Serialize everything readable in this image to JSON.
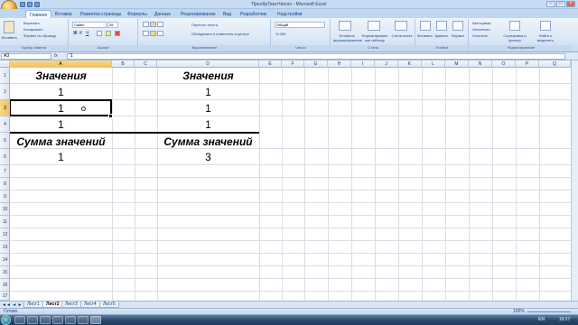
{
  "window": {
    "title": "ПреобрТекстЧисло - Microsoft Excel"
  },
  "tabs": [
    {
      "label": "Главная",
      "active": true
    },
    {
      "label": "Вставка",
      "active": false
    },
    {
      "label": "Разметка страницы",
      "active": false
    },
    {
      "label": "Формулы",
      "active": false
    },
    {
      "label": "Данные",
      "active": false
    },
    {
      "label": "Рецензирование",
      "active": false
    },
    {
      "label": "Вид",
      "active": false
    },
    {
      "label": "Разработчик",
      "active": false
    },
    {
      "label": "Надстройки",
      "active": false
    }
  ],
  "ribbon": {
    "clipboard": {
      "paste": "Вставить",
      "cut": "Вырезать",
      "copy": "Копировать",
      "format_painter": "Формат по образцу",
      "label": "Буфер обмена"
    },
    "font": {
      "name": "Calibri",
      "size": "26",
      "label": "Шрифт"
    },
    "alignment": {
      "wrap": "Перенос текста",
      "merge": "Объединить и поместить в центре",
      "label": "Выравнивание"
    },
    "number": {
      "format": "Общий",
      "label": "Число"
    },
    "styles": {
      "conditional": "Условное форматирование",
      "format_table": "Форматировать как таблицу",
      "cell_styles": "Стили ячеек",
      "label": "Стили"
    },
    "cells": {
      "insert": "Вставить",
      "delete": "Удалить",
      "format": "Формат",
      "label": "Ячейки"
    },
    "editing": {
      "autosum": "Автосумма",
      "fill": "Заполнить",
      "clear": "Очистить",
      "sort": "Сортировка и фильтр",
      "find": "Найти и выделить",
      "label": "Редактирование"
    }
  },
  "formula_bar": {
    "name_box": "A3",
    "fx": "fx",
    "content": "'1"
  },
  "columns": [
    "A",
    "B",
    "C",
    "D",
    "E",
    "F",
    "G",
    "H",
    "I",
    "J",
    "K",
    "L",
    "M",
    "N",
    "O",
    "P",
    "Q"
  ],
  "rows": [
    "1",
    "2",
    "3",
    "4",
    "5",
    "6",
    "7",
    "8",
    "9",
    "10",
    "11",
    "12",
    "13",
    "14",
    "15",
    "16",
    "17"
  ],
  "cells": {
    "A1": "Значения",
    "D1": "Значения",
    "A2": "1",
    "D2": "1",
    "A3": "1",
    "D3": "1",
    "A4": "1",
    "D4": "1",
    "A5": "Сумма значений",
    "D5": "Сумма значений",
    "A6": "1",
    "D6": "3"
  },
  "sheets": [
    {
      "label": "Лист1",
      "active": false
    },
    {
      "label": "Лист2",
      "active": true
    },
    {
      "label": "Лист3",
      "active": false
    },
    {
      "label": "Лист4",
      "active": false
    },
    {
      "label": "Лист5",
      "active": false
    }
  ],
  "status": {
    "text": "Готово",
    "zoom": "100%"
  },
  "taskbar": {
    "lang": "EN",
    "time": "19:27"
  }
}
